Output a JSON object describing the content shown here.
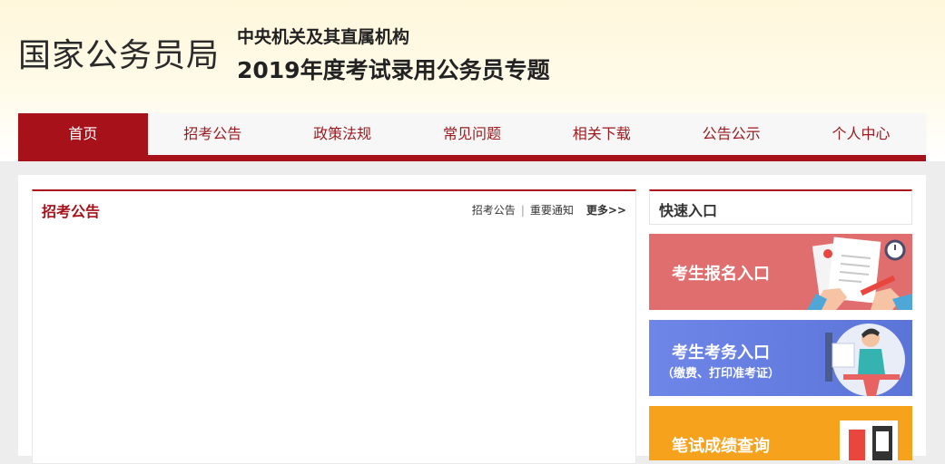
{
  "header": {
    "org_name": "国家公务员局",
    "subtitle_line1": "中央机关及其直属机构",
    "subtitle_line2": "2019年度考试录用公务员专题"
  },
  "nav": {
    "items": [
      {
        "label": "首页",
        "active": true
      },
      {
        "label": "招考公告",
        "active": false
      },
      {
        "label": "政策法规",
        "active": false
      },
      {
        "label": "常见问题",
        "active": false
      },
      {
        "label": "相关下载",
        "active": false
      },
      {
        "label": "公告公示",
        "active": false
      },
      {
        "label": "个人中心",
        "active": false
      }
    ]
  },
  "main": {
    "panel_title": "招考公告",
    "links": [
      "招考公告",
      "重要通知"
    ],
    "more_label": "更多>>"
  },
  "sidebar": {
    "title": "快速入口",
    "entries": [
      {
        "label": "考生报名入口",
        "sub": ""
      },
      {
        "label": "考生考务入口",
        "sub": "（缴费、打印准考证）"
      },
      {
        "label": "笔试成绩查询",
        "sub": ""
      }
    ]
  },
  "colors": {
    "brand_red": "#a6111a",
    "entry_red": "#e16e6e",
    "entry_blue": "#6e86e8",
    "entry_orange": "#f7a21c"
  }
}
